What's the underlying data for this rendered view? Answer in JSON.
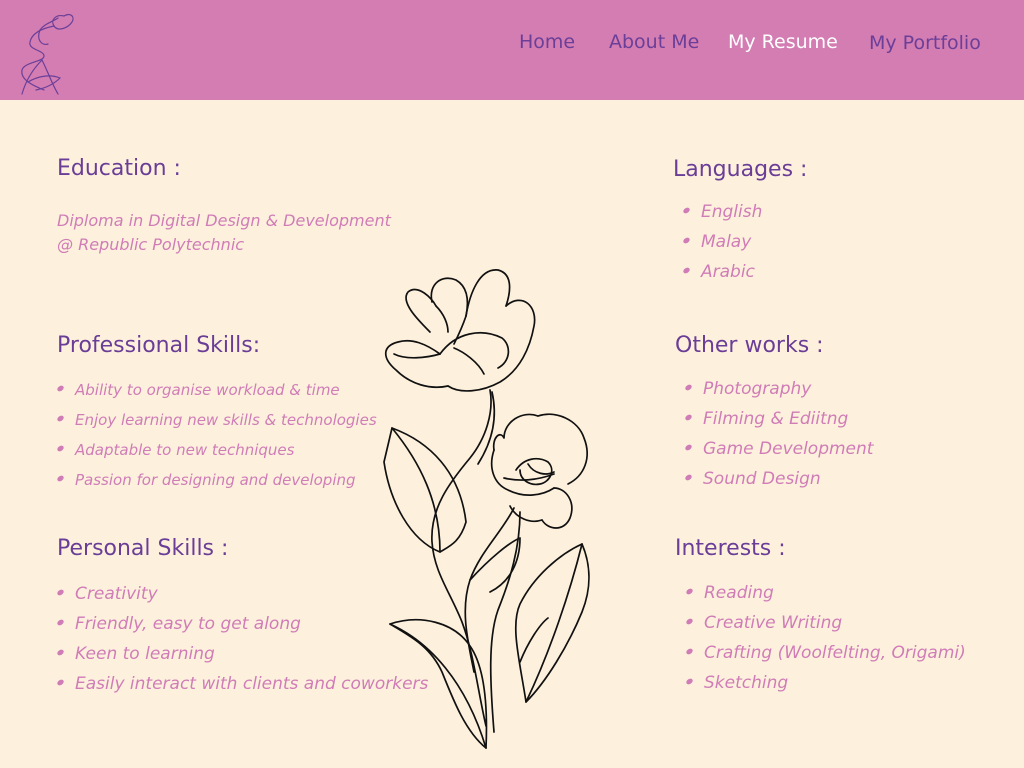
{
  "nav": {
    "items": [
      {
        "label": "Home"
      },
      {
        "label": "About Me"
      },
      {
        "label": "My Resume",
        "active": true
      },
      {
        "label": "My Portfolio"
      }
    ]
  },
  "education": {
    "heading": "Education :",
    "lines": [
      "Diploma in Digital Design & Development",
      "@ Republic Polytechnic"
    ]
  },
  "professional_skills": {
    "heading": "Professional Skills:",
    "items": [
      "Ability to organise workload & time",
      "Enjoy learning new skills & technologies",
      "Adaptable to new techniques",
      "Passion for designing and developing"
    ]
  },
  "personal_skills": {
    "heading": "Personal Skills :",
    "items": [
      "Creativity",
      "Friendly, easy to get along",
      "Keen to learning",
      "Easily interact with clients and coworkers"
    ]
  },
  "languages": {
    "heading": "Languages :",
    "items": [
      "English",
      "Malay",
      "Arabic"
    ]
  },
  "other_works": {
    "heading": "Other works :",
    "items": [
      "Photography",
      "Filming & Ediitng",
      "Game Development",
      "Sound Design"
    ]
  },
  "interests": {
    "heading": "Interests :",
    "items": [
      "Reading",
      "Creative Writing",
      "Crafting (Woolfelting, Origami)",
      "Sketching"
    ]
  },
  "colors": {
    "header_bg": "#d37db3",
    "page_bg": "#fdf1de",
    "heading": "#6a3d96",
    "body_text": "#d07cb6",
    "nav_active": "#ffffff"
  }
}
